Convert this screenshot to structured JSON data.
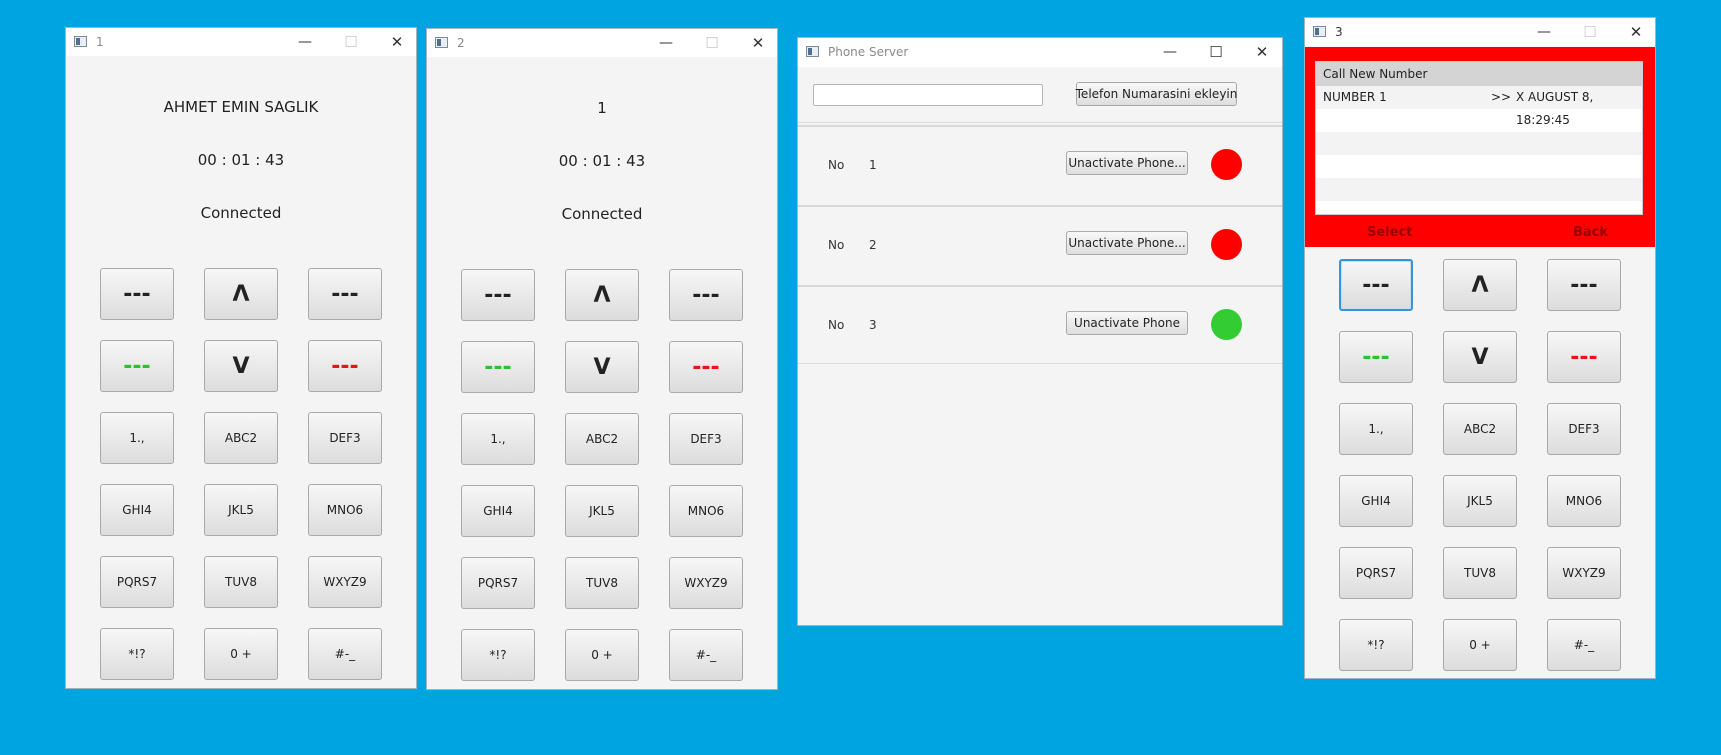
{
  "windows": {
    "phone1": {
      "title": "1",
      "display": {
        "name": "AHMET EMIN SAGLIK",
        "timer": "00 : 01 : 43",
        "status": "Connected"
      }
    },
    "phone2": {
      "title": "2",
      "display": {
        "name": "1",
        "timer": "00 : 01 : 43",
        "status": "Connected"
      }
    },
    "server": {
      "title": "Phone Server",
      "add_button": "Telefon Numarasini ekleyin",
      "input_value": "",
      "rows": [
        {
          "label": "No",
          "number": "1",
          "button": "Unactivate Phone...",
          "status_color": "#ff0000"
        },
        {
          "label": "No",
          "number": "2",
          "button": "Unactivate Phone...",
          "status_color": "#ff0000"
        },
        {
          "label": "No",
          "number": "3",
          "button": "Unactivate Phone",
          "status_color": "#33cc33"
        }
      ]
    },
    "phone3": {
      "title": "3",
      "call_list_header": "Call New Number",
      "call_entry": {
        "name": "NUMBER 1",
        "arrow": ">>",
        "info": "X AUGUST 8, 18:29:45"
      },
      "softkey_left": "Select",
      "softkey_right": "Back"
    }
  },
  "keypad": {
    "nav": [
      "---",
      "Λ",
      "---",
      "---",
      "V",
      "---"
    ],
    "keys": [
      "1.,",
      "ABC2",
      "DEF3",
      "GHI4",
      "JKL5",
      "MNO6",
      "PQRS7",
      "TUV8",
      "WXYZ9",
      "*!?",
      "0 +",
      "#-_"
    ]
  },
  "colors": {
    "desktop": "#00a4e1",
    "call_green": "#2ec02e",
    "hangup_red": "#ee1111",
    "phone3_panel": "#ff0000"
  }
}
